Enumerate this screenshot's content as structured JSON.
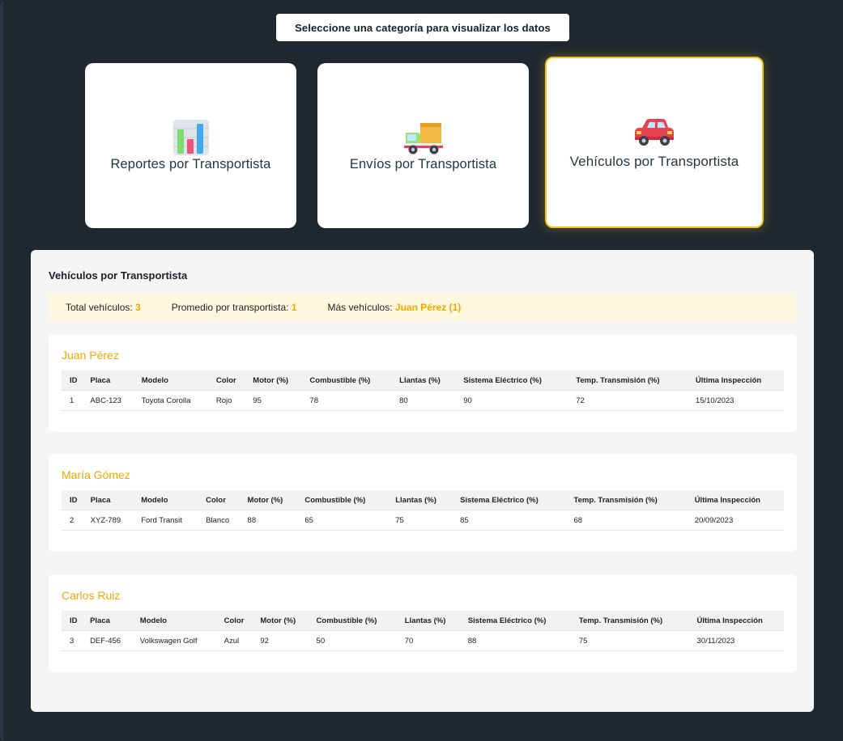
{
  "prompt": "Seleccione una categoría para visualizar los datos",
  "cards": [
    {
      "label": "Reportes por Transportista",
      "icon": "bar-chart-icon",
      "selected": false
    },
    {
      "label": "Envíos por Transportista",
      "icon": "delivery-truck-icon",
      "selected": false
    },
    {
      "label": "Vehículos por Transportista",
      "icon": "car-icon",
      "selected": true
    }
  ],
  "panel": {
    "title": "Vehículos por Transportista",
    "summary": {
      "total_label": "Total vehículos:",
      "total_value": "3",
      "avg_label": "Promedio por transportista:",
      "avg_value": "1",
      "most_label": "Más vehículos:",
      "most_value": "Juan Pérez (1)"
    }
  },
  "table_headers": [
    "ID",
    "Placa",
    "Modelo",
    "Color",
    "Motor (%)",
    "Combustible (%)",
    "Llantas (%)",
    "Sistema Eléctrico (%)",
    "Temp. Transmisión (%)",
    "Última Inspección"
  ],
  "groups": [
    {
      "name": "Juan Pérez",
      "rows": [
        [
          "1",
          "ABC-123",
          "Toyota Corolla",
          "Rojo",
          "95",
          "78",
          "80",
          "90",
          "72",
          "15/10/2023"
        ]
      ]
    },
    {
      "name": "María Gómez",
      "rows": [
        [
          "2",
          "XYZ-789",
          "Ford Transit",
          "Blanco",
          "88",
          "65",
          "75",
          "85",
          "68",
          "20/09/2023"
        ]
      ]
    },
    {
      "name": "Carlos Ruiz",
      "rows": [
        [
          "3",
          "DEF-456",
          "Volkswagen Golf",
          "Azul",
          "92",
          "50",
          "70",
          "88",
          "75",
          "30/11/2023"
        ]
      ]
    }
  ],
  "colors": {
    "background": "#1f2730",
    "accent": "#f0a800",
    "selected_border": "#f2c21a",
    "summary_bg": "#fff8df"
  }
}
